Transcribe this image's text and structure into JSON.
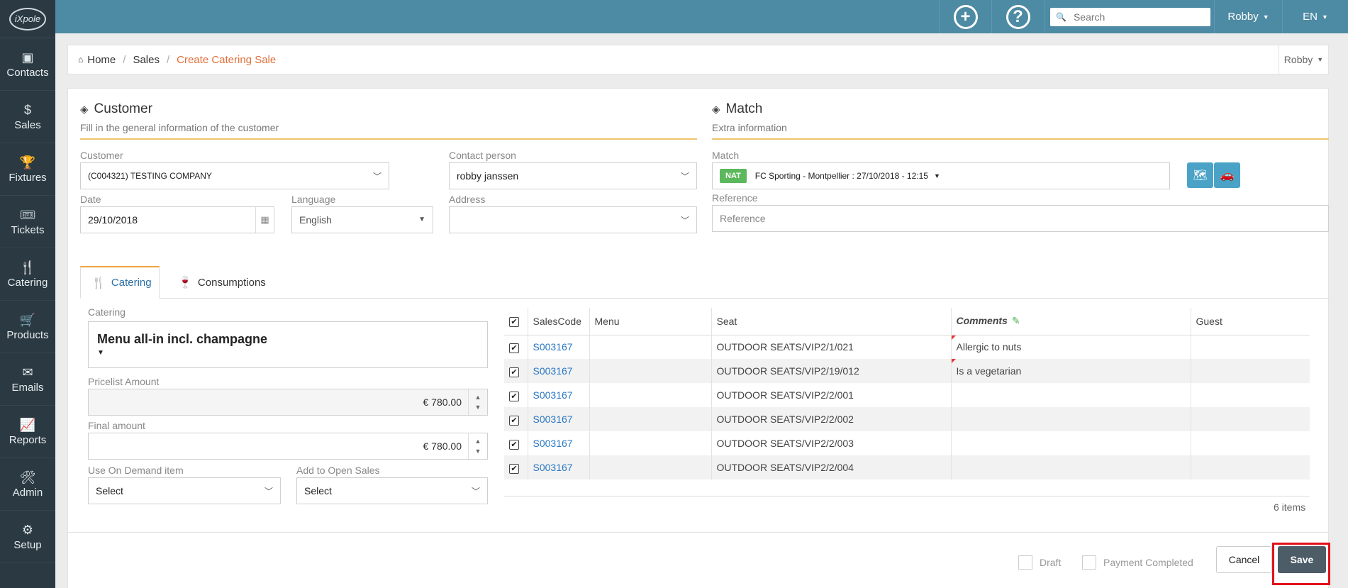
{
  "sidebar": {
    "logo_text": "iXpole",
    "items": [
      {
        "label": "Contacts",
        "icon": "contacts-icon",
        "glyph": "▣"
      },
      {
        "label": "Sales",
        "icon": "dollar-icon",
        "glyph": "$"
      },
      {
        "label": "Fixtures",
        "icon": "trophy-icon",
        "glyph": "🏆"
      },
      {
        "label": "Tickets",
        "icon": "ticket-icon",
        "glyph": "🎟"
      },
      {
        "label": "Catering",
        "icon": "cutlery-icon",
        "glyph": "🍴"
      },
      {
        "label": "Products",
        "icon": "cart-icon",
        "glyph": "🛒"
      },
      {
        "label": "Emails",
        "icon": "envelope-icon",
        "glyph": "✉"
      },
      {
        "label": "Reports",
        "icon": "chart-icon",
        "glyph": "📈"
      },
      {
        "label": "Admin",
        "icon": "tools-icon",
        "glyph": "🛠"
      },
      {
        "label": "Setup",
        "icon": "cogs-icon",
        "glyph": "⚙"
      }
    ]
  },
  "topbar": {
    "add_glyph": "+",
    "help_glyph": "?",
    "search_placeholder": "Search",
    "user": "Robby",
    "lang": "EN"
  },
  "breadcrumb": {
    "home": "Home",
    "sales": "Sales",
    "current": "Create Catering Sale",
    "user": "Robby"
  },
  "customer_section": {
    "title": "Customer",
    "subtitle": "Fill in the general information of the customer",
    "customer_label": "Customer",
    "customer_value": "(C004321) TESTING COMPANY",
    "contact_label": "Contact person",
    "contact_value": "robby janssen",
    "date_label": "Date",
    "date_value": "29/10/2018",
    "language_label": "Language",
    "language_value": "English",
    "address_label": "Address",
    "address_value": ""
  },
  "match_section": {
    "title": "Match",
    "subtitle": "Extra information",
    "match_label": "Match",
    "match_badge": "NAT",
    "match_value": "FC Sporting - Montpellier : 27/10/2018 - 12:15",
    "reference_label": "Reference",
    "reference_placeholder": "Reference"
  },
  "tabs": [
    {
      "label": "Catering"
    },
    {
      "label": "Consumptions"
    }
  ],
  "catering_form": {
    "catering_label": "Catering",
    "catering_value": "Menu all-in incl. champagne",
    "pricelist_label": "Pricelist Amount",
    "pricelist_value": "€ 780.00",
    "final_label": "Final amount",
    "final_value": "€ 780.00",
    "on_demand_label": "Use On Demand item",
    "on_demand_value": "Select",
    "open_sales_label": "Add to Open Sales",
    "open_sales_value": "Select"
  },
  "table": {
    "headers": [
      "SalesCode",
      "Menu",
      "Seat",
      "Comments",
      "Guest"
    ],
    "rows": [
      {
        "code": "S003167",
        "menu": "",
        "seat": "OUTDOOR SEATS/VIP2/1/021",
        "comment": "Allergic to nuts",
        "guest": ""
      },
      {
        "code": "S003167",
        "menu": "",
        "seat": "OUTDOOR SEATS/VIP2/19/012",
        "comment": "Is a vegetarian",
        "guest": ""
      },
      {
        "code": "S003167",
        "menu": "",
        "seat": "OUTDOOR SEATS/VIP2/2/001",
        "comment": "",
        "guest": ""
      },
      {
        "code": "S003167",
        "menu": "",
        "seat": "OUTDOOR SEATS/VIP2/2/002",
        "comment": "",
        "guest": ""
      },
      {
        "code": "S003167",
        "menu": "",
        "seat": "OUTDOOR SEATS/VIP2/2/003",
        "comment": "",
        "guest": ""
      },
      {
        "code": "S003167",
        "menu": "",
        "seat": "OUTDOOR SEATS/VIP2/2/004",
        "comment": "",
        "guest": ""
      }
    ],
    "items_count": "6 items"
  },
  "footer": {
    "draft_label": "Draft",
    "payment_label": "Payment Completed",
    "cancel_label": "Cancel",
    "save_label": "Save"
  },
  "colors": {
    "sidebar": "#2b3a42",
    "topbar": "#4d8aa3",
    "accent": "#e0703c",
    "highlight": "#e3101a"
  }
}
